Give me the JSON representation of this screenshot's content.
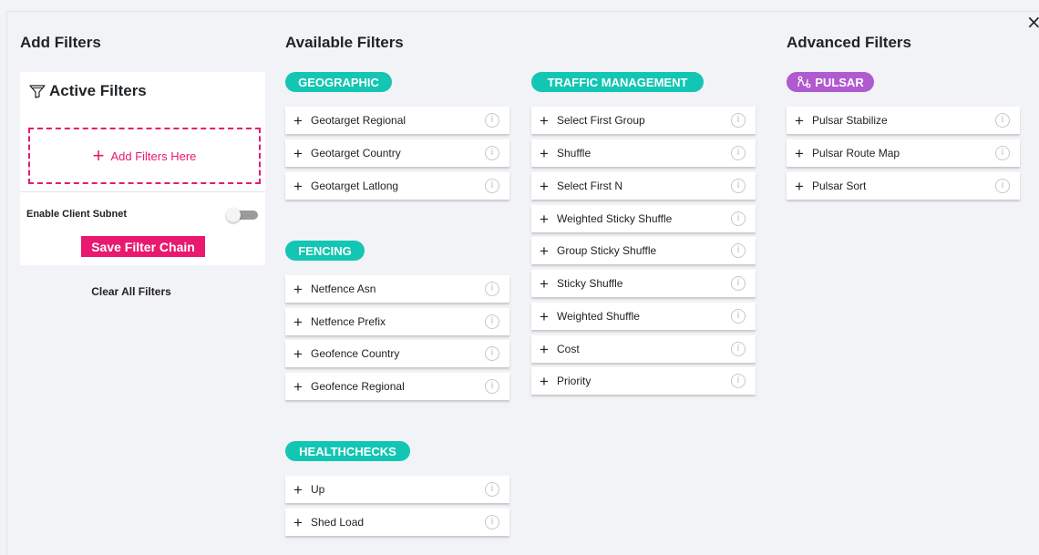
{
  "header": {
    "close_glyph": "×",
    "add_filters_title": "Add Filters",
    "available_filters_title": "Available Filters",
    "advanced_filters_title": "Advanced Filters"
  },
  "active_filters": {
    "title": "Active Filters",
    "dropzone_label": "Add Filters Here",
    "enable_client_subnet_label": "Enable Client Subnet",
    "enable_client_subnet_on": false,
    "save_button_label": "Save Filter Chain",
    "clear_all_label": "Clear All Filters"
  },
  "categories": {
    "geographic": {
      "name": "GEOGRAPHIC",
      "filters": [
        "Geotarget Regional",
        "Geotarget Country",
        "Geotarget Latlong"
      ]
    },
    "fencing": {
      "name": "FENCING",
      "filters": [
        "Netfence Asn",
        "Netfence Prefix",
        "Geofence Country",
        "Geofence Regional"
      ]
    },
    "healthchecks": {
      "name": "HEALTHCHECKS",
      "filters": [
        "Up",
        "Shed Load"
      ]
    },
    "traffic_management": {
      "name": "TRAFFIC MANAGEMENT",
      "filters": [
        "Select First Group",
        "Shuffle",
        "Select First N",
        "Weighted Sticky Shuffle",
        "Group Sticky Shuffle",
        "Sticky Shuffle",
        "Weighted Shuffle",
        "Cost",
        "Priority"
      ]
    },
    "pulsar": {
      "name": "PULSAR",
      "filters": [
        "Pulsar Stabilize",
        "Pulsar Route Map",
        "Pulsar Sort"
      ]
    }
  },
  "icons": {
    "add": "plus-icon",
    "info": "info-icon",
    "filter": "funnel-icon",
    "pulsar": "pulsar-icon",
    "close": "close-icon"
  },
  "colors": {
    "accent_pink": "#e8196e",
    "category_teal": "#13c6b3",
    "category_purple": "#b05ad0"
  }
}
